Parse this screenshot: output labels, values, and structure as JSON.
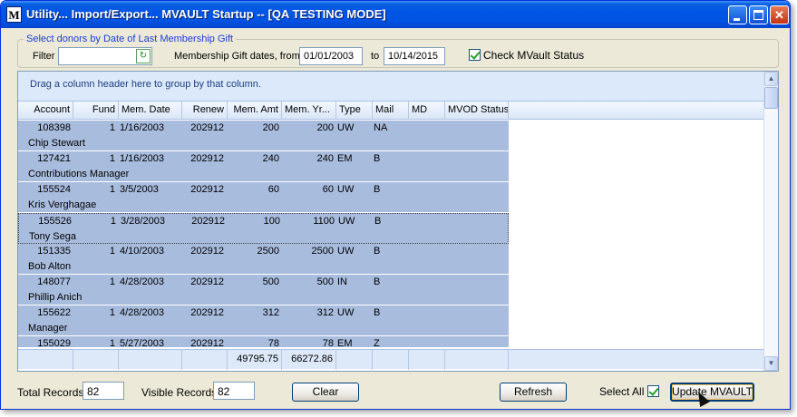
{
  "window": {
    "title": "Utility... Import/Export... MVAULT Startup -- [QA TESTING MODE]",
    "app_icon_letter": "M",
    "titlebar_color": "#0054e3"
  },
  "filters": {
    "group_title": "Select donors by Date of Last Membership Gift",
    "filter_label": "Filter",
    "filter_value": "",
    "dates_label": "Membership Gift dates, from",
    "date_from": "01/01/2003",
    "to_label": "to",
    "date_to": "10/14/2015",
    "check_mvault_label": "Check MVault Status",
    "check_mvault_checked": true
  },
  "grid": {
    "group_hint": "Drag a column header here to group by that column.",
    "columns": [
      "Account",
      "Fund",
      "Mem. Date",
      "Renew",
      "Mem. Amt",
      "Mem. Yr...",
      "Type",
      "Mail",
      "MD",
      "MVOD Status"
    ],
    "rows": [
      {
        "account": "108398",
        "fund": "1",
        "mem_date": "1/16/2003",
        "renew": "202912",
        "mem_amt": "200",
        "mem_yr": "200",
        "type": "UW",
        "mail": "NA",
        "md": "",
        "name": "Chip Stewart"
      },
      {
        "account": "127421",
        "fund": "1",
        "mem_date": "1/16/2003",
        "renew": "202912",
        "mem_amt": "240",
        "mem_yr": "240",
        "type": "EM",
        "mail": "B",
        "md": "",
        "name": "Contributions Manager"
      },
      {
        "account": "155524",
        "fund": "1",
        "mem_date": "3/5/2003",
        "renew": "202912",
        "mem_amt": "60",
        "mem_yr": "60",
        "type": "UW",
        "mail": "B",
        "md": "",
        "name": "Kris Verghagae"
      },
      {
        "account": "155526",
        "fund": "1",
        "mem_date": "3/28/2003",
        "renew": "202912",
        "mem_amt": "100",
        "mem_yr": "1100",
        "type": "UW",
        "mail": "B",
        "md": "",
        "name": "Tony Sega"
      },
      {
        "account": "151335",
        "fund": "1",
        "mem_date": "4/10/2003",
        "renew": "202912",
        "mem_amt": "2500",
        "mem_yr": "2500",
        "type": "UW",
        "mail": "B",
        "md": "",
        "name": "Bob Alton"
      },
      {
        "account": "148077",
        "fund": "1",
        "mem_date": "4/28/2003",
        "renew": "202912",
        "mem_amt": "500",
        "mem_yr": "500",
        "type": "IN",
        "mail": "B",
        "md": "",
        "name": "Phillip Anich"
      },
      {
        "account": "155622",
        "fund": "1",
        "mem_date": "4/28/2003",
        "renew": "202912",
        "mem_amt": "312",
        "mem_yr": "312",
        "type": "UW",
        "mail": "B",
        "md": "",
        "name": "Manager"
      },
      {
        "account": "155029",
        "fund": "1",
        "mem_date": "5/27/2003",
        "renew": "202912",
        "mem_amt": "78",
        "mem_yr": "78",
        "type": "EM",
        "mail": "Z",
        "md": "",
        "name": ""
      }
    ],
    "focused_row": 3,
    "totals": {
      "mem_amt": "49795.75",
      "mem_yr": "66272.86"
    },
    "selected_row_color": "#a8bcde"
  },
  "bottom": {
    "total_records_label": "Total Records",
    "total_records": "82",
    "visible_records_label": "Visible Records",
    "visible_records": "82",
    "clear_label": "Clear",
    "refresh_label": "Refresh",
    "select_all_label": "Select All",
    "select_all_checked": true,
    "update_label": "Update MVAULT"
  }
}
